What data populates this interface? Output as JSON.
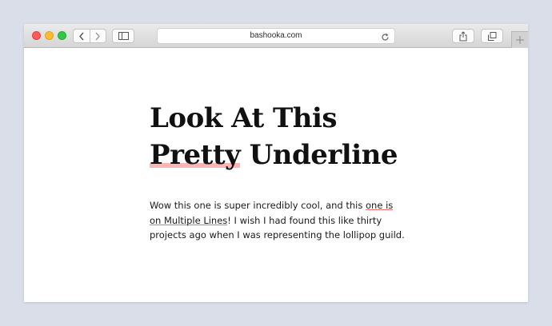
{
  "browser": {
    "url": "bashooka.com",
    "icons": {
      "back": "chevron-left-icon",
      "forward": "chevron-right-icon",
      "sidebar": "sidebar-icon",
      "reload": "reload-icon",
      "share": "share-icon",
      "tabs": "tabs-icon",
      "new_tab": "plus-icon"
    }
  },
  "page": {
    "heading_line1": "Look At This",
    "heading_highlight": "Pretty",
    "heading_rest": " Underline",
    "paragraph_part1": "Wow this one is super incredibly cool, and this ",
    "paragraph_link": "one is on Multiple Lines",
    "paragraph_part2": "! I wish I had found this like thirty projects ago when I was representing the lollipop guild."
  },
  "colors": {
    "background": "#d9dee8",
    "highlight": "#f57878",
    "link_underline": "#eb5050",
    "text": "#111111"
  }
}
